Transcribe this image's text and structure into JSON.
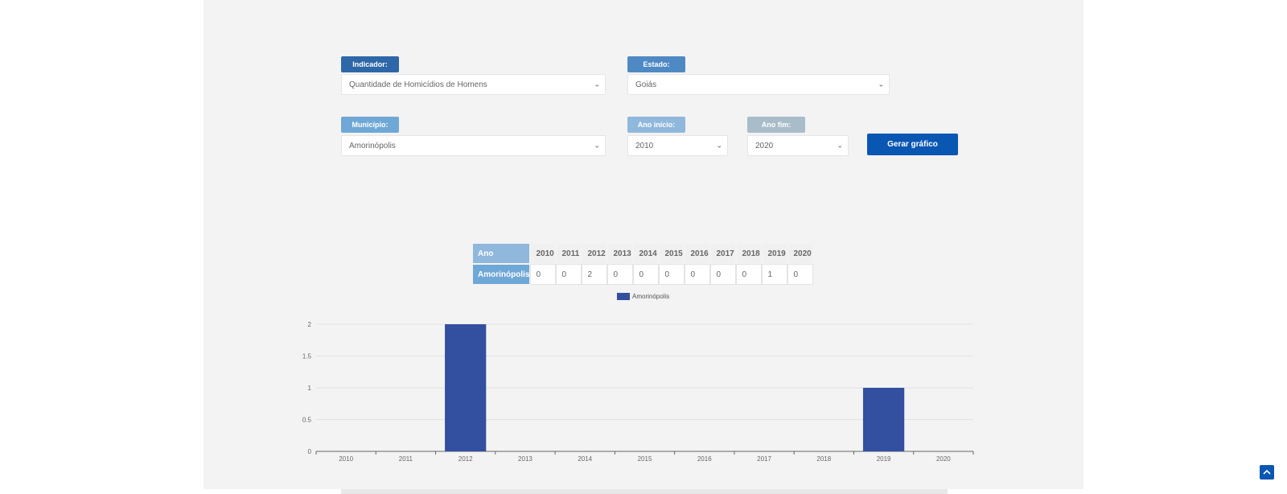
{
  "filters": {
    "indicador": {
      "label": "Indicador:",
      "value": "Quantidade de Homicídios de Homens"
    },
    "estado": {
      "label": "Estado:",
      "value": "Goiás"
    },
    "municipio": {
      "label": "Município:",
      "value": "Amorinópolis"
    },
    "ano_inicio": {
      "label": "Ano início:",
      "value": "2010"
    },
    "ano_fim": {
      "label": "Ano fim:",
      "value": "2020"
    },
    "generate_label": "Gerar gráfico"
  },
  "table": {
    "header_label": "Ano",
    "row_label": "Amorinópolis",
    "years": [
      "2010",
      "2011",
      "2012",
      "2013",
      "2014",
      "2015",
      "2016",
      "2017",
      "2018",
      "2019",
      "2020"
    ],
    "values": [
      "0",
      "0",
      "2",
      "0",
      "0",
      "0",
      "0",
      "0",
      "0",
      "1",
      "0"
    ]
  },
  "colors": {
    "bar": "#334f9f",
    "accent": "#0a56b3",
    "tag_dark": "#2e67a8",
    "tag_mid": "#6fa8d6",
    "tag_light": "#8fb8dc",
    "tag_gray": "#a9bcc9"
  },
  "chart_data": {
    "type": "bar",
    "categories": [
      "2010",
      "2011",
      "2012",
      "2013",
      "2014",
      "2015",
      "2016",
      "2017",
      "2018",
      "2019",
      "2020"
    ],
    "series": [
      {
        "name": "Amorinópolis",
        "values": [
          0,
          0,
          2,
          0,
          0,
          0,
          0,
          0,
          0,
          1,
          0
        ]
      }
    ],
    "yticks": [
      "0",
      "0.5",
      "1",
      "1.5",
      "2"
    ],
    "ylim": [
      0,
      2
    ],
    "legend": "top-center",
    "grid": true,
    "title": "",
    "xlabel": "",
    "ylabel": ""
  },
  "icons": {
    "scroll_top": "arrow-up-icon",
    "dropdown": "chevron-down-icon"
  }
}
